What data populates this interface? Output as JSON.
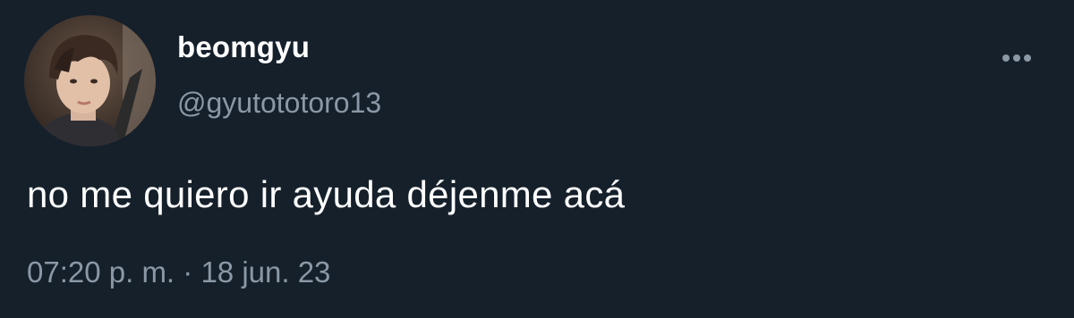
{
  "user": {
    "display_name": "beomgyu",
    "handle": "@gyutototoro13",
    "avatar_icon": "profile-photo"
  },
  "tweet": {
    "text": "no me quiero ir ayuda déjenme acá",
    "time": "07:20 p. m.",
    "separator": "·",
    "date": "18 jun. 23"
  },
  "actions": {
    "more_icon": "more-horizontal-icon"
  },
  "colors": {
    "background": "#15202b",
    "primary_text": "#ffffff",
    "secondary_text": "#8b98a5"
  }
}
